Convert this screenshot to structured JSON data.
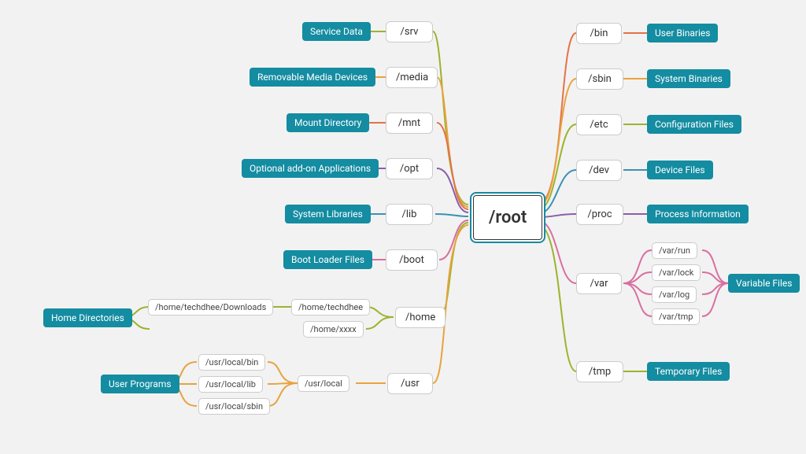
{
  "center": {
    "label": "/root"
  },
  "left": {
    "srv": {
      "path": "/srv",
      "desc": "Service Data"
    },
    "media": {
      "path": "/media",
      "desc": "Removable Media Devices"
    },
    "mnt": {
      "path": "/mnt",
      "desc": "Mount Directory"
    },
    "opt": {
      "path": "/opt",
      "desc": "Optional add-on Applications"
    },
    "lib": {
      "path": "/lib",
      "desc": "System Libraries"
    },
    "boot": {
      "path": "/boot",
      "desc": "Boot Loader Files"
    },
    "home": {
      "path": "/home",
      "desc": "Home Directories",
      "sub": {
        "techdhee": "/home/techdhee",
        "xxxx": "/home/xxxx",
        "downloads": "/home/techdhee/Downloads"
      }
    },
    "usr": {
      "path": "/usr",
      "desc": "User Programs",
      "sub": {
        "local": "/usr/local",
        "bin": "/usr/local/bin",
        "lib": "/usr/local/lib",
        "sbin": "/usr/local/sbin"
      }
    }
  },
  "right": {
    "bin": {
      "path": "/bin",
      "desc": "User Binaries"
    },
    "sbin": {
      "path": "/sbin",
      "desc": "System Binaries"
    },
    "etc": {
      "path": "/etc",
      "desc": "Configuration Files"
    },
    "dev": {
      "path": "/dev",
      "desc": "Device Files"
    },
    "proc": {
      "path": "/proc",
      "desc": "Process Information"
    },
    "var": {
      "path": "/var",
      "desc": "Variable Files",
      "sub": {
        "run": "/var/run",
        "lock": "/var/lock",
        "log": "/var/log",
        "tmp": "/var/tmp"
      }
    },
    "tmp": {
      "path": "/tmp",
      "desc": "Temporary Files"
    }
  }
}
